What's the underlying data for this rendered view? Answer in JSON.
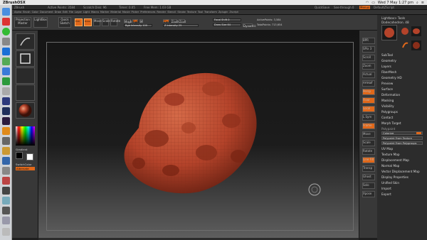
{
  "mac_menubar": {
    "app_name": "ZBrushOSX",
    "clock": "Wed 7 May  1:27 pm"
  },
  "zbrush_titlebar": {
    "title_items": [
      "ZBrush",
      "Active Points: 3584",
      "Scratch Disk: 96",
      "Timer: 0.05",
      "Free Mem: 1.03 GB"
    ],
    "quicksave": "QuickSave",
    "see_through": "See-through 0",
    "menus": "Menus",
    "default_script": "DefaultZScript"
  },
  "menu_items": [
    "Alpha",
    "Brush",
    "Color",
    "Document",
    "Draw",
    "Edit",
    "File",
    "Layer",
    "Light",
    "Macro",
    "Marker",
    "Material",
    "Movie",
    "Picker",
    "Preferences",
    "Render",
    "Stencil",
    "Stroke",
    "Texture",
    "Tool",
    "Transform",
    "Zplugin",
    "Zscript"
  ],
  "shelf": {
    "projection_master": "Projection Master",
    "lightbox": "LightBox",
    "quick_sketch": "Quick Sketch",
    "edit": "Edit",
    "draw": "Draw",
    "move": "Move",
    "scale": "Scale",
    "rotate": "Rotate",
    "mrgb": "Mrgb",
    "rgb": "Rgb",
    "m": "M",
    "rgb_intensity": "Rgb Intensity 100",
    "zadd": "Zadd",
    "zsub": "Zsub",
    "zcut": "Zcut",
    "z_intensity": "Z Intensity 25",
    "focal_shift": "Focal Shift 0",
    "draw_size": "Draw Size 64",
    "dynamic": "Dynamic",
    "active_points": "ActivePoints: 3,584",
    "total_points": "TotalPoints: 713,654"
  },
  "left_shelf": {
    "gradient": "Gradient",
    "switch_color": "SwitchColor",
    "alternate": "Alternate"
  },
  "right_shelf": [
    "BPR",
    "SPix 3",
    "Scroll",
    "Zoom",
    "Actual",
    "AAHalf",
    "Persp",
    "Floor",
    "Local",
    "L.Sym",
    "Frame",
    "Move",
    "Scale",
    "Rotate",
    "Line Fill",
    "Transp",
    "Ghost",
    "Solo",
    "Xpose"
  ],
  "tool_tray": {
    "header": "Lightbox> Tools",
    "current_tool": "Dodecahedron. 48",
    "tool_thumbs": [
      "Dodecahedron",
      "Cylinder3D",
      "PolyMesh3D",
      "SimpleBrush"
    ],
    "sections": [
      "SubTool",
      "Geometry",
      "Layers",
      "FiberMesh",
      "Geometry HD",
      "Preview",
      "Surface",
      "Deformation",
      "Masking",
      "Visibility",
      "Polygroups",
      "Contact",
      "Morph Target"
    ],
    "polypaint": {
      "label": "Polypaint",
      "colorize": "Colorize",
      "from_texture": "Polypaint From Texture",
      "from_polygroups": "Polypaint From Polygroups"
    },
    "sections_2": [
      "UV Map",
      "Texture Map",
      "Displacement Map",
      "Normal Map",
      "Vector Displacement Map",
      "Display Properties",
      "Unified Skin",
      "Import",
      "Export"
    ]
  },
  "colors": {
    "accent_orange": "#e0681a",
    "mesh_red": "#b8462c",
    "panel_dark": "#2c2c2c"
  }
}
